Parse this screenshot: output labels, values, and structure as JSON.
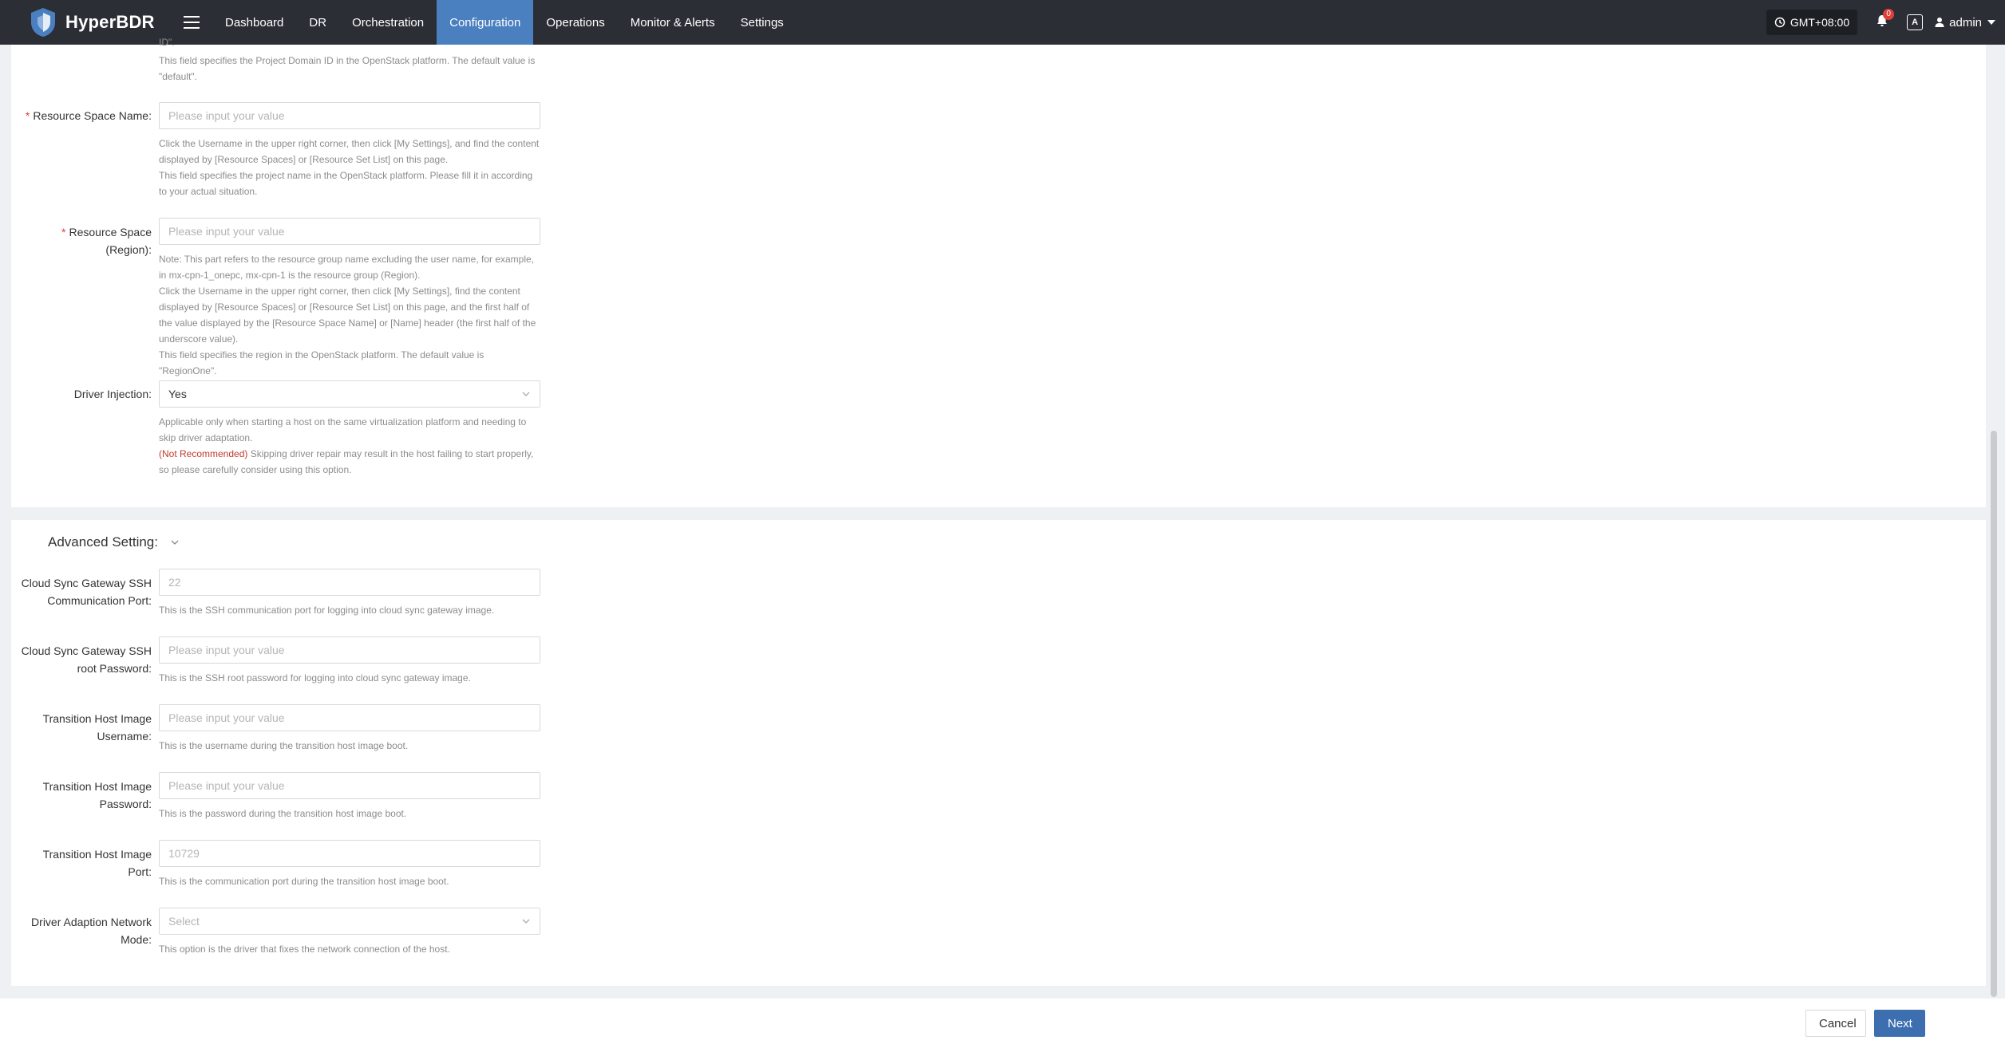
{
  "app": {
    "name": "HyperBDR"
  },
  "nav": {
    "items": [
      {
        "label": "Dashboard",
        "active": false
      },
      {
        "label": "DR",
        "active": false
      },
      {
        "label": "Orchestration",
        "active": false
      },
      {
        "label": "Configuration",
        "active": true
      },
      {
        "label": "Operations",
        "active": false
      },
      {
        "label": "Monitor & Alerts",
        "active": false
      },
      {
        "label": "Settings",
        "active": false
      }
    ],
    "timezone": "GMT+08:00",
    "notification_count": "0",
    "lang_icon_text": "A",
    "user": "admin"
  },
  "form": {
    "project_domain": {
      "help_cut": "ID\".",
      "help": "This field specifies the Project Domain ID in the OpenStack platform. The default value is \"default\"."
    },
    "resource_space_name": {
      "label": "Resource Space Name:",
      "placeholder": "Please input your value",
      "help1": "Click the Username in the upper right corner, then click [My Settings], and find the content displayed by [Resource Spaces] or [Resource Set List] on this page.",
      "help2": "This field specifies the project name in the OpenStack platform. Please fill it in according to your actual situation."
    },
    "resource_space_region": {
      "label_line1": "Resource Space",
      "label_line2": "(Region):",
      "placeholder": "Please input your value",
      "help1": "Note: This part refers to the resource group name excluding the user name, for example, in mx-cpn-1_onepc, mx-cpn-1 is the resource group (Region).",
      "help2": "Click the Username in the upper right corner, then click [My Settings], find the content displayed by [Resource Spaces] or [Resource Set List] on this page, and the first half of the value displayed by the [Resource Space Name] or [Name] header (the first half of the underscore value).",
      "help3": "This field specifies the region in the OpenStack platform. The default value is \"RegionOne\"."
    },
    "driver_injection": {
      "label": "Driver Injection:",
      "value": "Yes",
      "help1": "Applicable only when starting a host on the same virtualization platform and needing to skip driver adaptation.",
      "help_warn": "(Not Recommended)",
      "help2": " Skipping driver repair may result in the host failing to start properly, so please carefully consider using this option."
    }
  },
  "advanced": {
    "title": "Advanced Setting:",
    "ssh_port": {
      "label_line1": "Cloud Sync Gateway SSH",
      "label_line2": "Communication Port:",
      "placeholder": "22",
      "help": "This is the SSH communication port for logging into cloud sync gateway image."
    },
    "ssh_password": {
      "label_line1": "Cloud Sync Gateway SSH",
      "label_line2": "root Password:",
      "placeholder": "Please input your value",
      "help": "This is the SSH root password for logging into cloud sync gateway image."
    },
    "th_username": {
      "label_line1": "Transition Host Image",
      "label_line2": "Username:",
      "placeholder": "Please input your value",
      "help": "This is the username during the transition host image boot."
    },
    "th_password": {
      "label_line1": "Transition Host Image",
      "label_line2": "Password:",
      "placeholder": "Please input your value",
      "help": "This is the password during the transition host image boot."
    },
    "th_port": {
      "label_line1": "Transition Host Image",
      "label_line2": "Port:",
      "placeholder": "10729",
      "help": "This is the communication port during the transition host image boot."
    },
    "network_mode": {
      "label_line1": "Driver Adaption Network",
      "label_line2": "Mode:",
      "placeholder": "Select",
      "help": "This option is the driver that fixes the network connection of the host."
    }
  },
  "footer": {
    "cancel": "Cancel",
    "next": "Next"
  },
  "colors": {
    "nav_bg": "#2b2f35",
    "nav_active": "#4a7fc0",
    "primary_button": "#3d6fb0",
    "required": "#e0403a"
  }
}
